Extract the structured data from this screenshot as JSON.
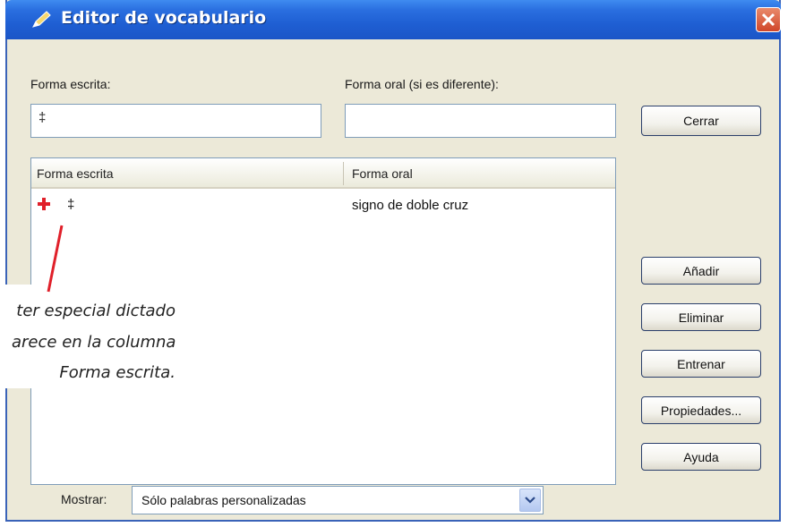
{
  "window": {
    "title": "Editor de vocabulario"
  },
  "form": {
    "written_label": "Forma escrita:",
    "written_value": "‡",
    "spoken_label": "Forma oral (si es diferente):",
    "spoken_value": ""
  },
  "list": {
    "columns": [
      "Forma escrita",
      "Forma oral"
    ],
    "rows": [
      {
        "written": "‡",
        "spoken": "signo de doble cruz"
      }
    ]
  },
  "buttons": {
    "close": "Cerrar",
    "add": "Añadir",
    "delete": "Eliminar",
    "train": "Entrenar",
    "properties": "Propiedades...",
    "help": "Ayuda"
  },
  "show": {
    "label": "Mostrar:",
    "value": "Sólo palabras personalizadas"
  },
  "annotation": {
    "line1": "ter especial dictado",
    "line2": "arece en la columna",
    "line3": "Forma escrita."
  },
  "colors": {
    "accent_red": "#e0202a",
    "title_blue": "#1f5fd3"
  }
}
